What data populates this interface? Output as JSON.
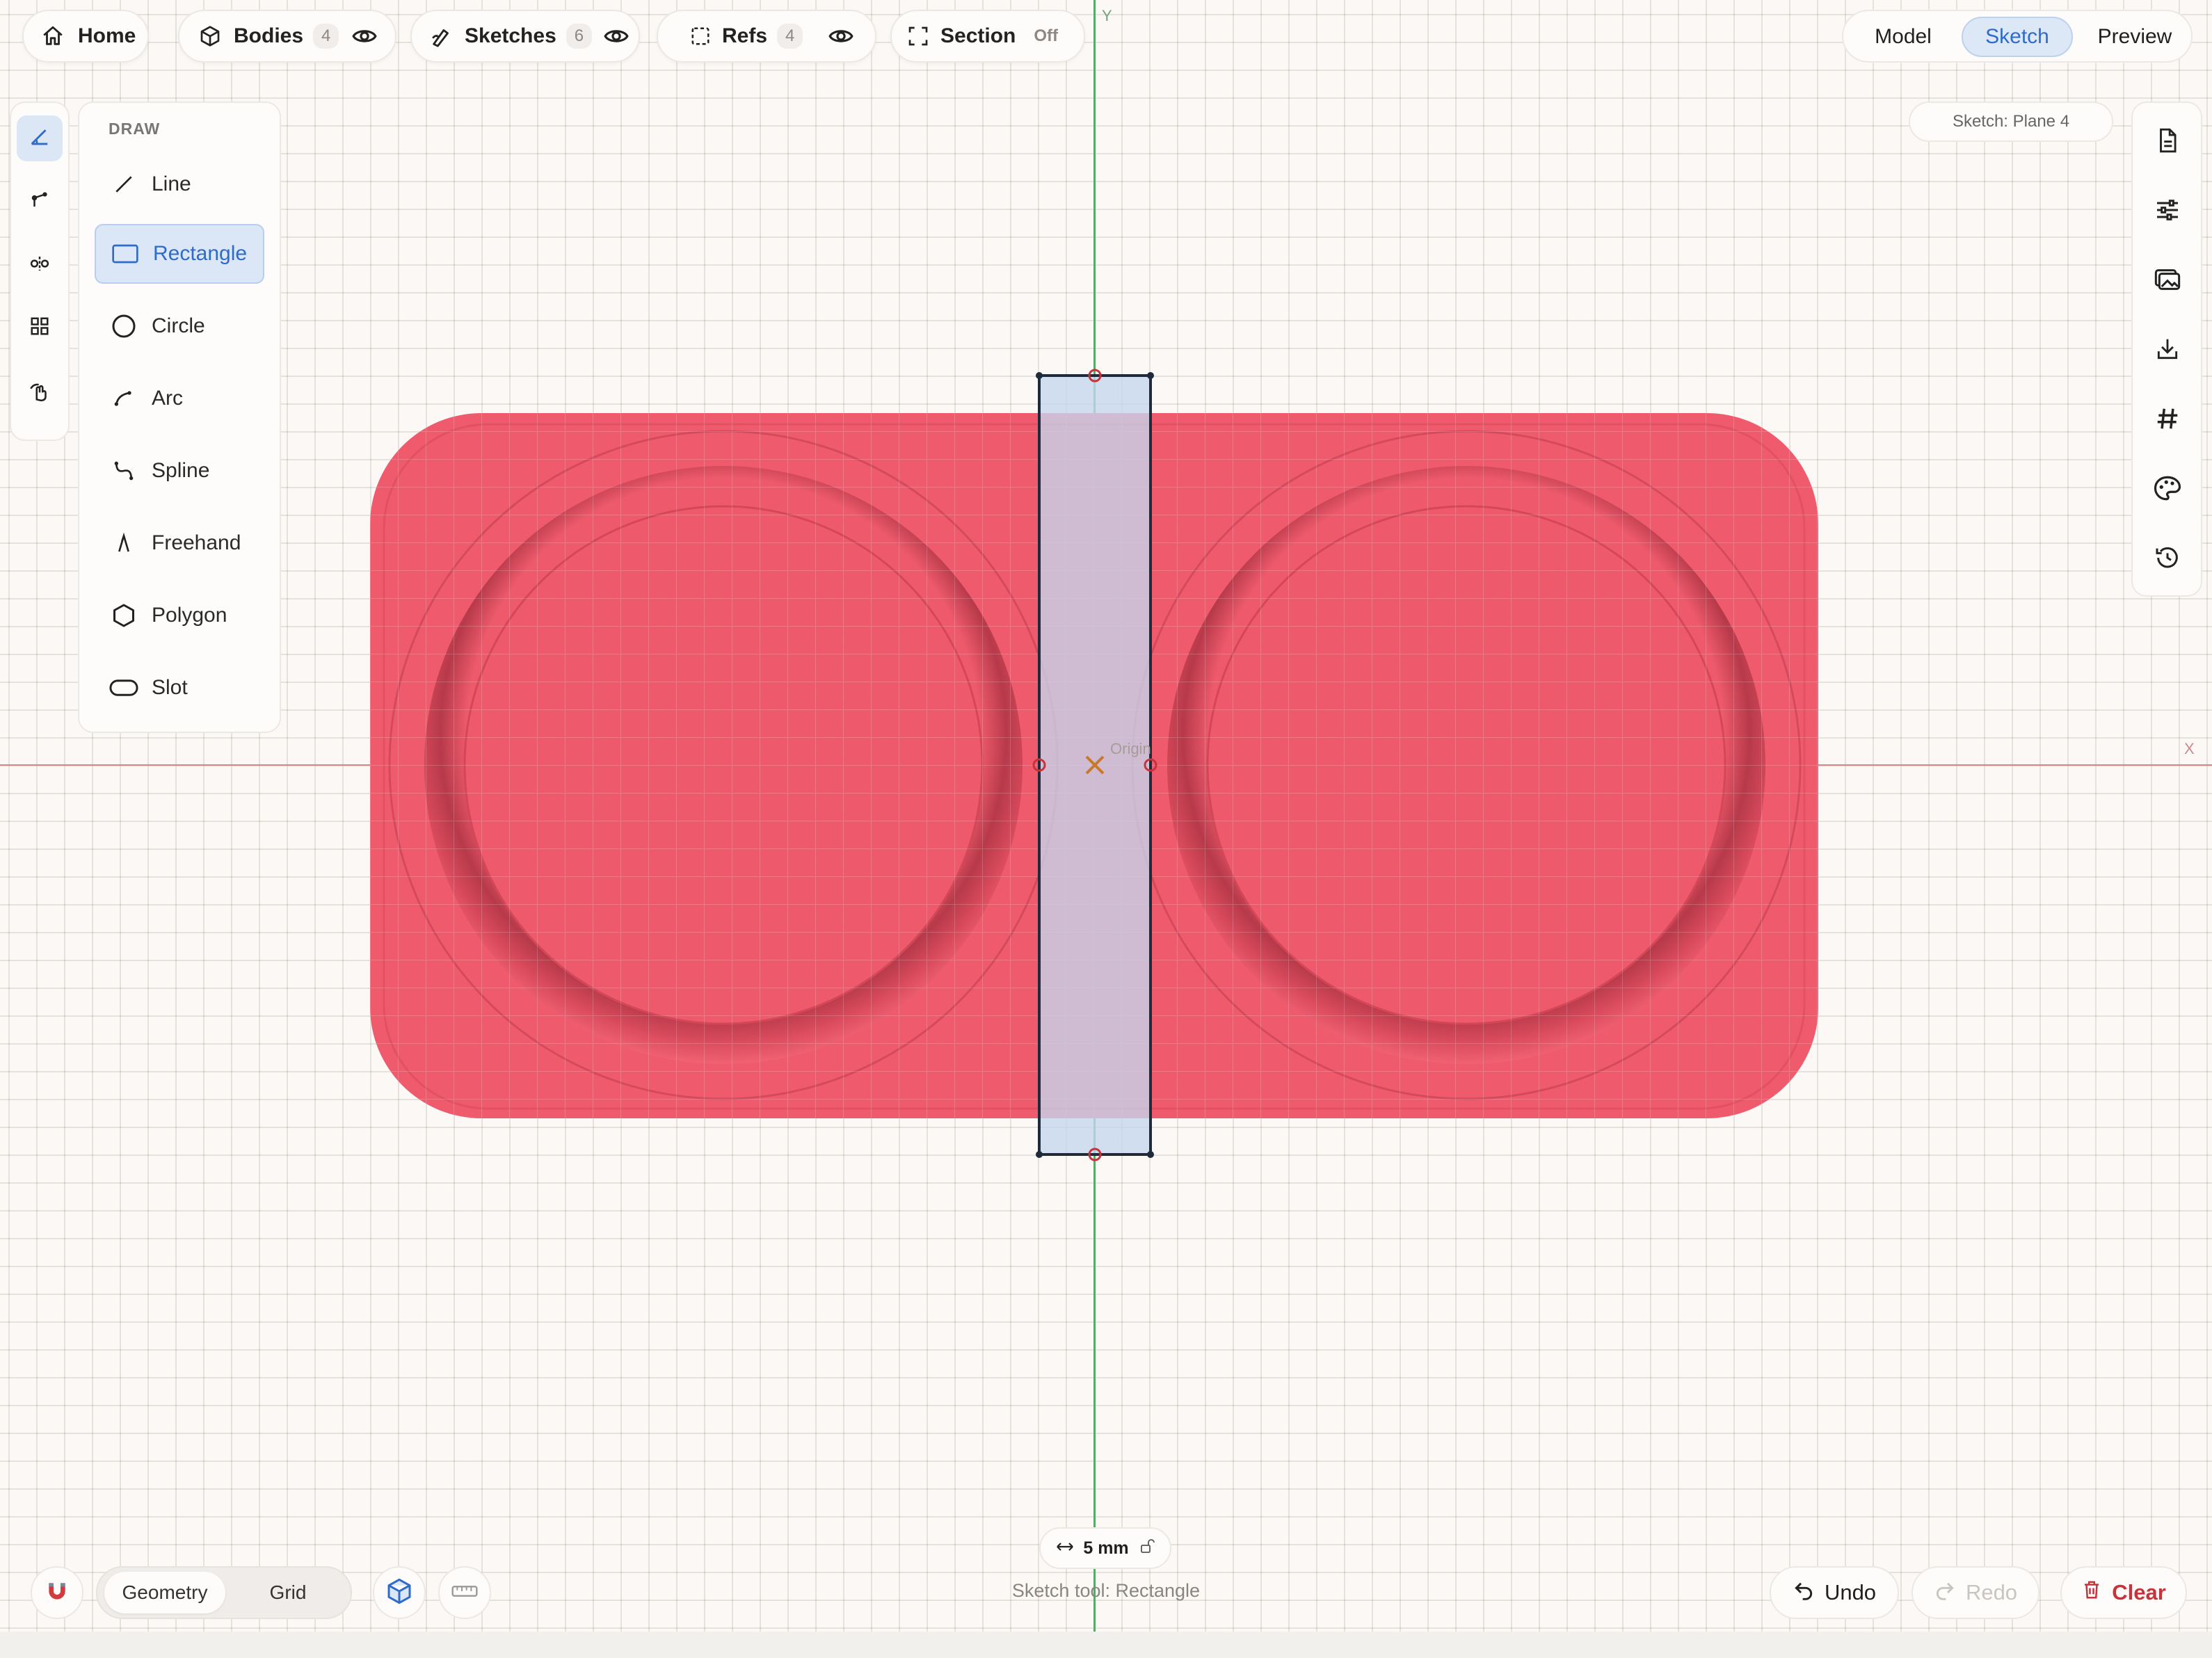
{
  "toolbar": {
    "home_label": "Home",
    "bodies_label": "Bodies",
    "bodies_count": "4",
    "sketches_label": "Sketches",
    "sketches_count": "6",
    "refs_label": "Refs",
    "refs_count": "4",
    "section_label": "Section",
    "section_state": "Off"
  },
  "mode": {
    "options": [
      "Model",
      "Sketch",
      "Preview"
    ],
    "active": "Sketch"
  },
  "sketch_plane": "Sketch: Plane 4",
  "axes": {
    "y_label": "Y",
    "x_label": "X",
    "origin_label": "Origin"
  },
  "draw_panel": {
    "title": "DRAW",
    "tools": [
      {
        "label": "Line",
        "icon": "line-icon"
      },
      {
        "label": "Rectangle",
        "icon": "rectangle-icon"
      },
      {
        "label": "Circle",
        "icon": "circle-icon"
      },
      {
        "label": "Arc",
        "icon": "arc-icon"
      },
      {
        "label": "Spline",
        "icon": "spline-icon"
      },
      {
        "label": "Freehand",
        "icon": "freehand-icon"
      },
      {
        "label": "Polygon",
        "icon": "polygon-icon"
      },
      {
        "label": "Slot",
        "icon": "slot-icon"
      }
    ],
    "active_tool": "Rectangle"
  },
  "left_rail": [
    "draw-icon",
    "constraint-icon",
    "mirror-icon",
    "pattern-icon",
    "select-hand-icon"
  ],
  "right_rail": [
    "document-icon",
    "sliders-icon",
    "images-icon",
    "download-icon",
    "hash-icon",
    "palette-icon",
    "history-icon"
  ],
  "dimension": {
    "value": "5 mm"
  },
  "status_text": "Sketch tool: Rectangle",
  "snap": {
    "options": [
      "Geometry",
      "Grid"
    ],
    "active": "Geometry"
  },
  "actions": {
    "undo": "Undo",
    "redo": "Redo",
    "clear": "Clear"
  },
  "colors": {
    "accent": "#2f6bc8",
    "model_fill": "#ef5c6e",
    "danger": "#c8323a",
    "axis_y": "#5aa96a",
    "axis_x": "#d68888"
  }
}
